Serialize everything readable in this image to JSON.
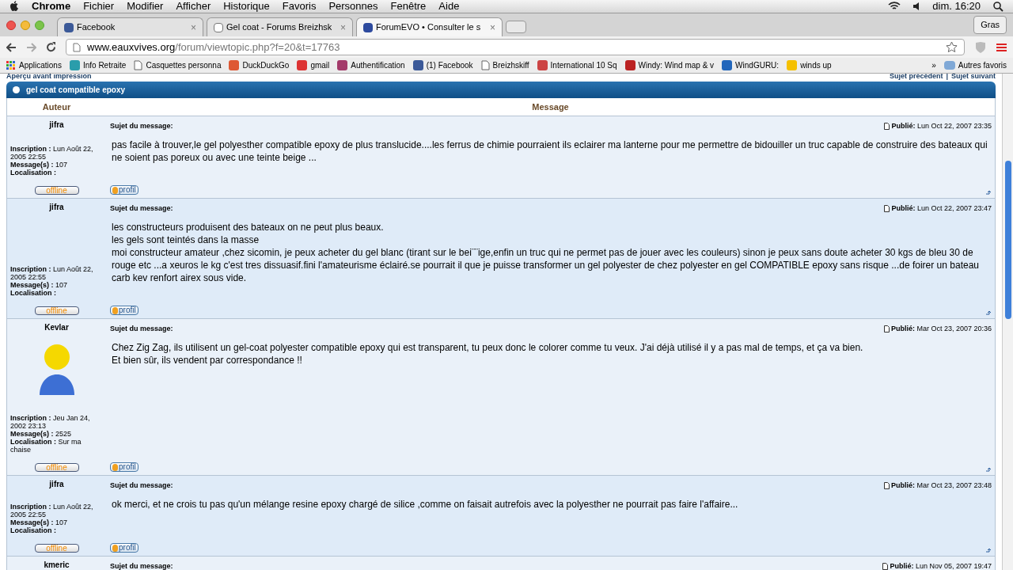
{
  "menubar": {
    "app": "Chrome",
    "menus": [
      "Fichier",
      "Modifier",
      "Afficher",
      "Historique",
      "Favoris",
      "Personnes",
      "Fenêtre",
      "Aide"
    ],
    "clock": "dim. 16:20"
  },
  "tabs": [
    {
      "title": "Facebook",
      "close": "×",
      "selected": false
    },
    {
      "title": "Gel coat - Forums Breizhsk",
      "close": "×",
      "selected": false
    },
    {
      "title": "ForumEVO • Consulter le s",
      "close": "×",
      "selected": true
    }
  ],
  "profile_button": "Gras",
  "address": {
    "host": "www.eauxvives.org",
    "path": "/forum/viewtopic.php?f=20&t=17763"
  },
  "bookmarks": [
    {
      "label": "Applications"
    },
    {
      "label": "Info Retraite"
    },
    {
      "label": "Casquettes personna"
    },
    {
      "label": "DuckDuckGo"
    },
    {
      "label": "gmail"
    },
    {
      "label": "Authentification"
    },
    {
      "label": "(1) Facebook"
    },
    {
      "label": "Breizhskiff"
    },
    {
      "label": "International 10 Sq"
    },
    {
      "label": "Windy: Wind map & v"
    },
    {
      "label": "WindGURU:"
    },
    {
      "label": "winds up"
    }
  ],
  "bookmarks_more": "»",
  "other_bookmarks": "Autres favoris",
  "page": {
    "print_link": "Aperçu avant impression",
    "prev_link": "Sujet précédent",
    "separator": "|",
    "next_link": "Sujet suivant",
    "topic_title": "gel coat compatible epoxy",
    "columns": [
      "Auteur",
      "Message"
    ],
    "posts": [
      {
        "author": "jifra",
        "avatar": false,
        "joined": "**Inscription :** Lun Août 22, 2005 22:55",
        "messages": "**Message(s) :** 107",
        "location": "**Localisation :**",
        "status": "offline",
        "profile": "profil",
        "subject_label": "Sujet du message:",
        "published": "**Publié:** Lun Oct 22, 2007 23:35",
        "lines": [
          "pas facile à trouver,le gel polyesther compatible epoxy de plus translucide....les ferrus de chimie pourraient ils eclairer ma lanterne pour me permettre de bidouiller un truc capable de construire des bateaux qui ne soient pas poreux ou avec une teinte beige ..."
        ]
      },
      {
        "author": "jifra",
        "avatar": false,
        "joined": "**Inscription :** Lun Août 22, 2005 22:55",
        "messages": "**Message(s) :** 107",
        "location": "**Localisation :**",
        "status": "offline",
        "profile": "profil",
        "subject_label": "Sujet du message:",
        "published": "**Publié:** Lun Oct 22, 2007 23:47",
        "lines": [
          "les constructeurs produisent des bateaux on ne peut plus beaux.",
          "les gels sont teintés dans la masse",
          "moi constructeur amateur ,chez sicomin, je peux acheter du gel blanc (tirant sur le bei¨¨ige,enfin un truc qui ne permet pas de jouer avec les couleurs) sinon je peux sans doute acheter 30 kgs de bleu 30 de rouge etc ...a xeuros le kg c'est tres dissuasif.fini l'amateurisme éclairé.se pourrait il que je puisse transformer un gel polyester de chez polyester en gel COMPATIBLE epoxy sans risque ...de foirer un bateau carb kev renfort airex sous vide."
        ]
      },
      {
        "author": "Kevlar",
        "avatar": true,
        "joined": "**Inscription :** Jeu Jan 24, 2002 23:13",
        "messages": "**Message(s) :** 2525",
        "location": "**Localisation :** Sur ma chaise",
        "status": "offline",
        "profile": "profil",
        "subject_label": "Sujet du message:",
        "published": "**Publié:** Mar Oct 23, 2007 20:36",
        "lines": [
          "Chez Zig Zag, ils utilisent un gel-coat polyester compatible epoxy qui est transparent, tu peux donc le colorer comme tu veux. J'ai déjà utilisé il y a pas mal de temps, et ça va bien.",
          "Et bien sûr, ils vendent par correspondance !!"
        ]
      },
      {
        "author": "jifra",
        "avatar": false,
        "joined": "**Inscription :** Lun Août 22, 2005 22:55",
        "messages": "**Message(s) :** 107",
        "location": "**Localisation :**",
        "status": "offline",
        "profile": "profil",
        "subject_label": "Sujet du message:",
        "published": "**Publié:** Mar Oct 23, 2007 23:48",
        "lines": [
          "ok merci, et ne crois tu pas qu'un mélange resine epoxy chargé de silice ,comme on faisait autrefois avec la polyesther ne pourrait pas faire l'affaire..."
        ]
      },
      {
        "author": "kmeric",
        "avatar": false,
        "subject_label": "Sujet du message:",
        "published": "**Publié:** Lun Nov 05, 2007 19:47"
      }
    ]
  }
}
